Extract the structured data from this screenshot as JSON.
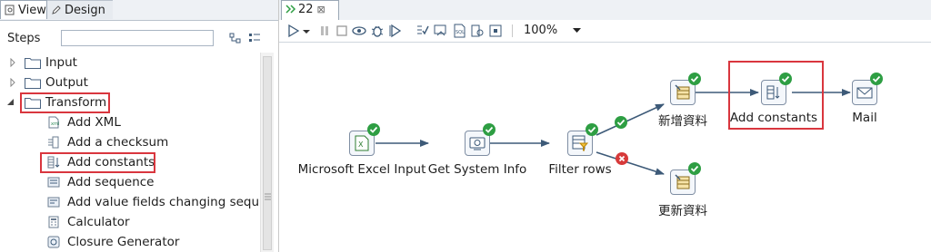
{
  "left_panel": {
    "tabs": {
      "view": "View",
      "design": "Design"
    },
    "steps_label": "Steps",
    "search": {
      "value": "",
      "placeholder": ""
    },
    "tree": {
      "folders": [
        {
          "label": "Input",
          "expanded": false
        },
        {
          "label": "Output",
          "expanded": false
        },
        {
          "label": "Transform",
          "expanded": true,
          "highlighted": true
        }
      ],
      "steps": [
        {
          "label": "Add XML",
          "icon": "add-xml-icon"
        },
        {
          "label": "Add a checksum",
          "icon": "checksum-icon"
        },
        {
          "label": "Add constants",
          "icon": "add-constants-icon",
          "highlighted": true
        },
        {
          "label": "Add sequence",
          "icon": "sequence-icon"
        },
        {
          "label": "Add value fields changing sequence",
          "icon": "value-fields-icon"
        },
        {
          "label": "Calculator",
          "icon": "calculator-icon"
        },
        {
          "label": "Closure Generator",
          "icon": "closure-icon"
        }
      ]
    }
  },
  "editor": {
    "tab": {
      "label": "22",
      "close": "⊠"
    },
    "toolbar": {
      "buttons": [
        "run-icon",
        "run-dropdown-icon",
        "pause-icon",
        "stop-icon",
        "preview-icon",
        "debug-icon",
        "replay-icon",
        "verify-icon",
        "impact-icon",
        "sql-icon",
        "explore-db-icon",
        "show-results-icon",
        "align-icon"
      ],
      "zoom": "100%"
    },
    "nodes": [
      {
        "label": "Microsoft Excel Input",
        "icon": "excel-input-icon",
        "status": "ok"
      },
      {
        "label": "Get System Info",
        "icon": "system-info-icon",
        "status": "ok"
      },
      {
        "label": "Filter rows",
        "icon": "filter-rows-icon",
        "status": "ok"
      },
      {
        "label": "新增資料",
        "icon": "insert-update-icon",
        "status": "ok"
      },
      {
        "label": "Add constants",
        "icon": "add-constants-icon",
        "status": "ok",
        "highlighted": true
      },
      {
        "label": "Mail",
        "icon": "mail-icon",
        "status": "ok"
      },
      {
        "label": "更新資料",
        "icon": "update-icon",
        "status": "ok"
      }
    ],
    "hops": [
      {
        "from": "Microsoft Excel Input",
        "to": "Get System Info"
      },
      {
        "from": "Get System Info",
        "to": "Filter rows"
      },
      {
        "from": "Filter rows",
        "to": "新增資料",
        "condition": "true"
      },
      {
        "from": "Filter rows",
        "to": "更新資料",
        "condition": "false"
      },
      {
        "from": "新增資料",
        "to": "Add constants"
      },
      {
        "from": "Add constants",
        "to": "Mail"
      }
    ]
  },
  "colors": {
    "highlight": "#d9363e",
    "ok": "#2e9e43",
    "error": "#d73a3a",
    "hop": "#3d5a78"
  }
}
